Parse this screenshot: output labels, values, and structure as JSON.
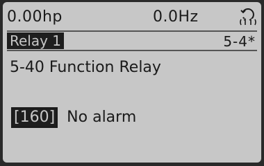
{
  "status": {
    "power": "0.00hp",
    "frequency": "0.0Hz",
    "setup_icon": "setup-1-icon"
  },
  "menu": {
    "title": "Relay 1",
    "code": "5-4*"
  },
  "parameter": {
    "title": "5-40 Function Relay",
    "value_code": "[160]",
    "value_text": "No alarm"
  },
  "colors": {
    "lcd_background": "#c7c7c7",
    "text": "#1a1a1a",
    "highlight_background": "#1e1e1e"
  }
}
